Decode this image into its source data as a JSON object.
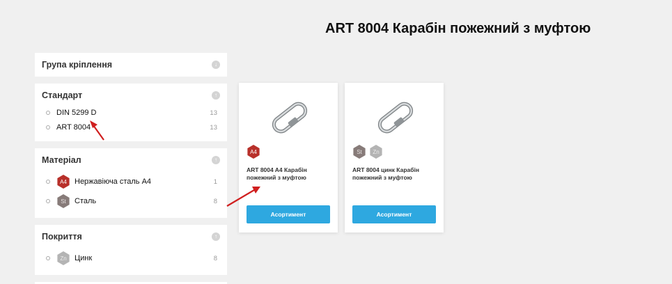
{
  "page_title": "ART 8004 Карабін пожежний з муфтою",
  "filters": {
    "group": {
      "title": "Група кріплення",
      "toggle": "↓"
    },
    "standard": {
      "title": "Стандарт",
      "toggle": "↑",
      "options": [
        {
          "label": "DIN 5299 D",
          "count": "13"
        },
        {
          "label": "ART 8004",
          "count": "13"
        }
      ]
    },
    "material": {
      "title": "Матеріал",
      "toggle": "↑",
      "options": [
        {
          "badge": "A4",
          "label": "Нержавіюча сталь A4",
          "count": "1"
        },
        {
          "badge": "St",
          "label": "Сталь",
          "count": "8"
        }
      ]
    },
    "coating": {
      "title": "Покриття",
      "toggle": "↑",
      "options": [
        {
          "badge": "Zn",
          "label": "Цинк",
          "count": "8"
        }
      ]
    }
  },
  "products": [
    {
      "badges": [
        "A4"
      ],
      "name": "ART 8004 A4 Карабін пожежний з муфтою",
      "button": "Асортимент"
    },
    {
      "badges": [
        "St",
        "Zn"
      ],
      "name": "ART 8004 цинк Карабін пожежний з муфтою",
      "button": "Асортимент"
    }
  ],
  "colors": {
    "accent": "#2ea8e0",
    "annotation": "#d01f1f",
    "badge_a4": "#b8302a",
    "badge_st": "#877b79",
    "badge_zn": "#b4b4b4"
  }
}
